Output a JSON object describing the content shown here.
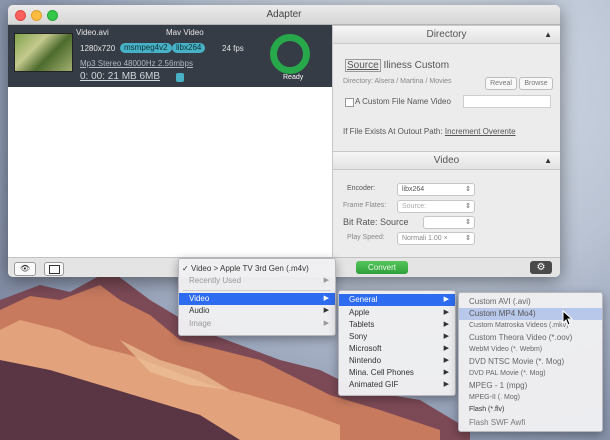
{
  "window": {
    "title": "Adapter"
  },
  "job": {
    "input_name": "Video.avi",
    "output_name": "Mav Video",
    "resolution": "1280x720",
    "codec_from": "msmpeg4v2",
    "codec_arrow": "▸",
    "codec_to": "libx264",
    "fps": "24 fps",
    "audio": "Mp3 Stereo 48000Hz 2.56mbps",
    "duration_size": "0: 00: 21 MB 6MB",
    "status": "Ready"
  },
  "directory": {
    "header": "Directory",
    "source_label": "Source",
    "custom_label": "Iliness Custom",
    "path": "Directory: Alsera / Martina / Movies",
    "reveal": "Reveal",
    "browse": "Browse",
    "custom_name_label": "A Custom File Name Video",
    "exists_label": "If File Exists At Outout Path:",
    "exists_value": "Increment Overente"
  },
  "video": {
    "header": "Video",
    "encoder_label": "Encoder:",
    "encoder_value": "libx264",
    "frame_rates_label": "Frame Flates:",
    "frame_rates_value": "Source:",
    "bit_rate_label": "Bit Rate:",
    "bit_rate_value": "Source",
    "play_speed_label": "Play Speed:",
    "play_speed_value": "Normali 1.00 ×"
  },
  "toolbar": {
    "convert": "Convert",
    "eye_icon": "eye-icon",
    "terminal_icon": "terminal-icon",
    "gear_icon": "gear-icon"
  },
  "menu1": {
    "checked": "Video > Apple TV 3rd Gen (.m4v)",
    "recent": "Recently Used",
    "items": [
      "Video",
      "Audio",
      "Image"
    ]
  },
  "menu2": {
    "items": [
      "General",
      "Apple",
      "Tablets",
      "Sony",
      "Microsoft",
      "Nintendo",
      "Mina. Cell Phones",
      "Animated GIF"
    ]
  },
  "menu3": {
    "items": [
      "Custom AVI (.avi)",
      "Custom MP4 Mo4)",
      "Custom Matroska Videos (.mkv)",
      "Custom Theora Video (*.oov)",
      "WebM Video (*. Webm)",
      "DVD NTSC Movie (*. Mog)",
      "DVD PAL Movie (*. Mog)",
      "MPEG - 1 (mpg)",
      "MPEG-II (. Mog)",
      "Flash (*.flv)",
      "Flash SWF Awfi"
    ]
  }
}
